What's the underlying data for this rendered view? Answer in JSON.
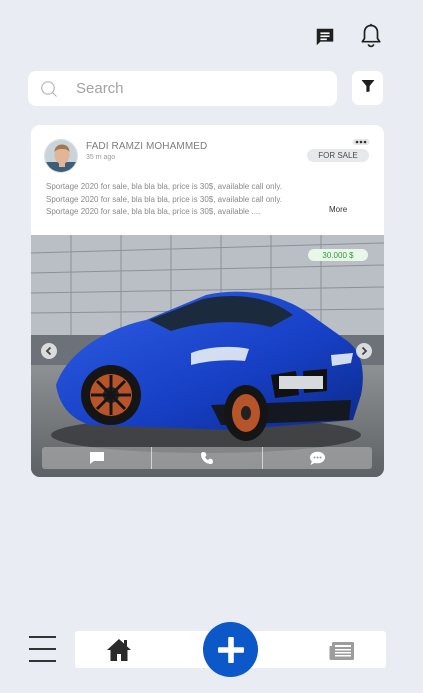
{
  "header": {
    "chat_icon": "chat-icon",
    "bell_icon": "bell-icon"
  },
  "search": {
    "placeholder": "Search",
    "icon": "search-icon"
  },
  "filter": {
    "icon": "filter-icon"
  },
  "post": {
    "author": "FADI RAMZI MOHAMMED",
    "time": "35 m ago",
    "badge": "FOR SALE",
    "description_lines": [
      "Sportage 2020 for sale, bla bla bla, price is 30$, available call only.",
      "Sportage 2020 for sale, bla bla bla, price is 30$, available call only.",
      "Sportage 2020 for sale, bla bla bla, price is 30$, available ...."
    ],
    "more_label": "More",
    "price": "30.000 $",
    "actions": [
      "message-icon",
      "phone-icon",
      "chat-bubble-icon"
    ]
  },
  "bottom_nav": {
    "menu_icon": "hamburger-icon",
    "home_icon": "home-icon",
    "add_icon": "plus-icon",
    "news_icon": "newspaper-icon"
  },
  "colors": {
    "background": "#e9ecf2",
    "accent": "#0c58c8",
    "price_green": "#2e9e3a"
  }
}
